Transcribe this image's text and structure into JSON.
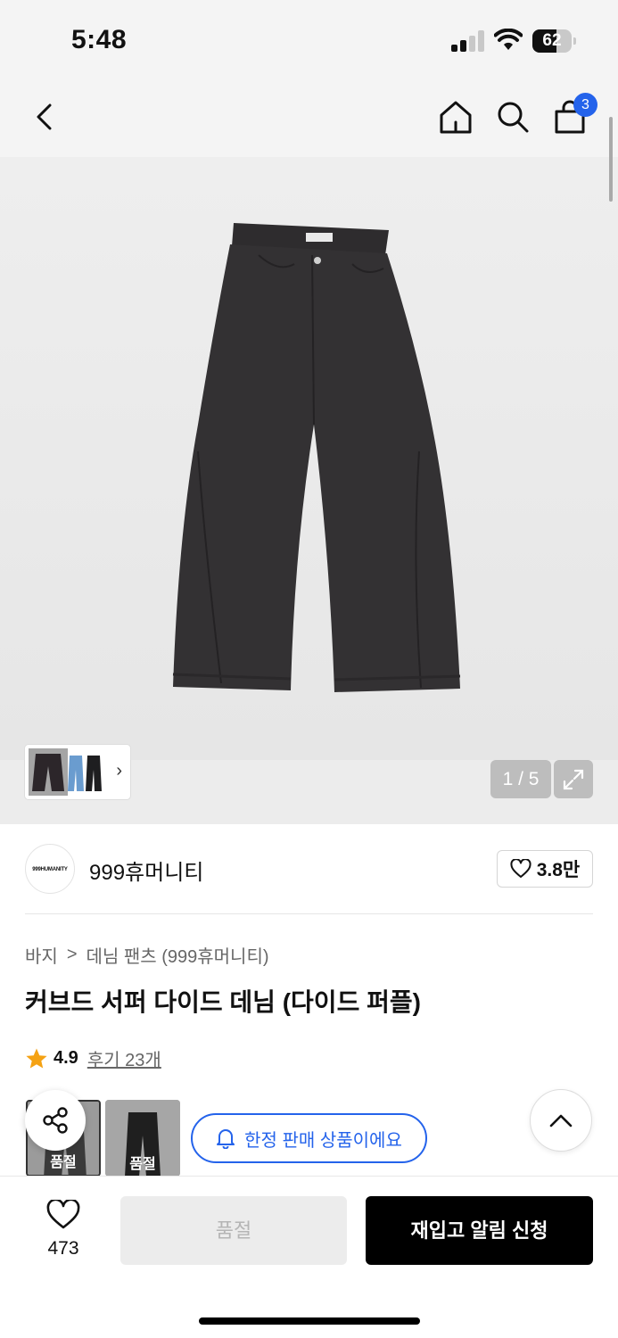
{
  "status_bar": {
    "time": "5:48",
    "battery": "62",
    "battery_level": 0.62
  },
  "nav": {
    "cart_count": "3",
    "accent_color": "#2463eb"
  },
  "gallery": {
    "counter": "1 / 5",
    "thumb_more": "›"
  },
  "brand": {
    "logo_text": "999HUMANITY",
    "name": "999휴머니티",
    "likes": "3.8만"
  },
  "breadcrumb": {
    "category": "바지",
    "separator": ">",
    "subcategory": "데님 팬츠 (999휴머니티)"
  },
  "product": {
    "title": "커브드 서퍼 다이드 데님 (다이드 퍼플)",
    "rating": "4.9",
    "reviews": "후기 23개"
  },
  "options": {
    "sold_label_1": "품절",
    "sold_label_2": "품절",
    "limited_label": "한정 판매 상품이에요"
  },
  "bottom": {
    "wish_count": "473",
    "soldout_label": "품절",
    "restock_label": "재입고 알림 신청"
  },
  "icons": [
    "back-icon",
    "home-icon",
    "search-icon",
    "cart-icon",
    "expand-icon",
    "heart-icon",
    "star-icon",
    "share-icon",
    "bell-icon",
    "chevron-up-icon"
  ]
}
